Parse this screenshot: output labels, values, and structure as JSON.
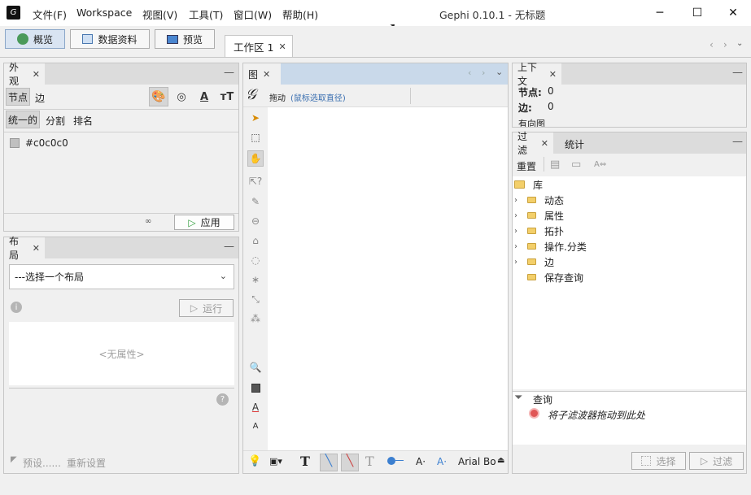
{
  "app": {
    "logo_icon": "gephi-logo-icon",
    "title": "Gephi 0.10.1 - 无标题",
    "menu": [
      "文件(F)",
      "Workspace",
      "视图(V)",
      "工具(T)",
      "窗口(W)",
      "帮助(H)"
    ]
  },
  "mode_buttons": {
    "overview": "概览",
    "data_lab": "数据资料",
    "preview": "预览"
  },
  "workspace_tab": "工作区 1",
  "appearance": {
    "tab": "外观",
    "element_tabs": [
      "节点",
      "边"
    ],
    "sub_tabs": [
      "统一的",
      "分割",
      "排名"
    ],
    "color_value": "#c0c0c0",
    "apply": "应用"
  },
  "layout": {
    "tab": "布局",
    "select_placeholder": "---选择一个布局",
    "run": "运行",
    "no_properties": "<无属性>",
    "presets": "预设......",
    "reset": "重新设置"
  },
  "graph": {
    "tab": "图",
    "drag_label": "拖动",
    "drag_hint": "(鼠标选取直径)",
    "font_label": "Arial Bo"
  },
  "context": {
    "tab": "上下文",
    "nodes_label": "节点:",
    "nodes_value": "0",
    "edges_label": "边:",
    "edges_value": "0",
    "graph_type": "有向图"
  },
  "filters": {
    "tab_filter": "过滤",
    "tab_stats": "统计",
    "reset": "重置",
    "library": "库",
    "items": [
      "动态",
      "属性",
      "拓扑",
      "操作.分类",
      "边"
    ],
    "saved_queries": "保存查询",
    "queries_label": "查询",
    "drop_hint": "将子滤波器拖动到此处",
    "select_btn": "选择",
    "filter_btn": "过滤"
  },
  "colors": {
    "accent": "#3b7fd0",
    "panel_bg": "#f0f0f0",
    "tab_bar": "#dcdcdc"
  }
}
